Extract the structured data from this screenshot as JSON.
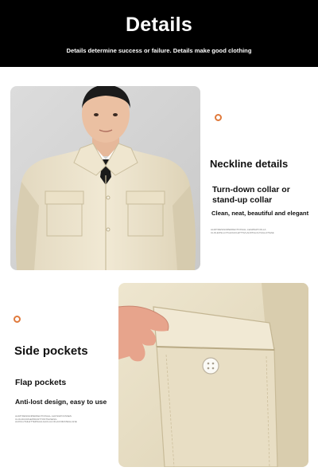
{
  "banner": {
    "title": "Details",
    "subtitle": "Details determine success or failure. Details make good clothing"
  },
  "section1": {
    "title": "Neckline details",
    "subtitle": "Turn-down collar or stand-up collar",
    "description": "Clean, neat, beautiful and elegant",
    "fine_print_1": "ALIMYDESIGNPERFECTIONALL LEAMSATCOLLA",
    "fine_print_2": "CLOLEOSLLCTGLFIACLETTSVLALMTGLCLTAALLFTEAE"
  },
  "section2": {
    "title": "Side pockets",
    "subtitle": "Flap pockets",
    "description": "Anti-lost design, easy to use",
    "fine_print_1": "ALIMYDESIGNPERFECTIONALL ALIFSGPOCSSES",
    "fine_print_2": "CLOLDCCRGEPRGSITTONTSASESG",
    "fine_print_3": "ALRCLLTAILETTERSAALGACLALCFLACNIRATEGLGNE"
  },
  "colors": {
    "banner_bg": "#000000",
    "accent": "#e07a3c",
    "fabric": "#ece3cc"
  },
  "icons": [
    "circle-marker-icon"
  ]
}
